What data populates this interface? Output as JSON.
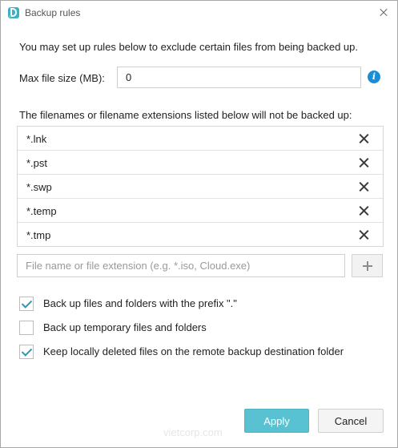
{
  "window": {
    "title": "Backup rules",
    "icon": "app-logo-icon",
    "close_icon": "close-icon"
  },
  "intro_text": "You may set up rules below to exclude certain files from being backed up.",
  "max_file_size": {
    "label": "Max file size (MB):",
    "value": "0",
    "info_icon": "info-icon"
  },
  "exclusions": {
    "label": "The filenames or filename extensions listed below will not be backed up:",
    "items": [
      "*.lnk",
      "*.pst",
      "*.swp",
      "*.temp",
      "*.tmp"
    ],
    "remove_icon": "close-icon"
  },
  "add_entry": {
    "placeholder": "File name or file extension (e.g. *.iso, Cloud.exe)",
    "value": "",
    "add_icon": "plus-icon"
  },
  "options": [
    {
      "label": "Back up files and folders with the prefix \".\"",
      "checked": true
    },
    {
      "label": "Back up temporary files and folders",
      "checked": false
    },
    {
      "label": "Keep locally deleted files on the remote backup destination folder",
      "checked": true
    }
  ],
  "footer": {
    "watermark": "vietcorp.com",
    "apply_label": "Apply",
    "cancel_label": "Cancel"
  },
  "colors": {
    "accent": "#58c2d3",
    "checkmark": "#2a9ab8",
    "info": "#1a8cd8"
  }
}
